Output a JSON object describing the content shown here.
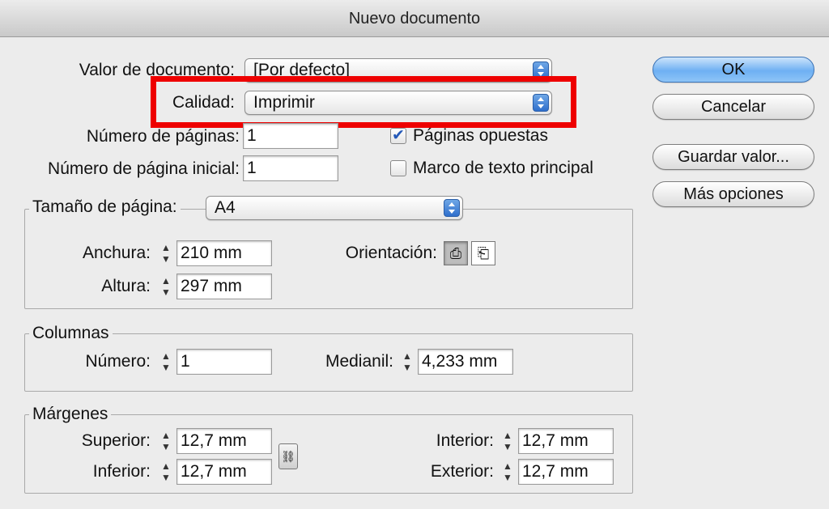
{
  "window": {
    "title": "Nuevo documento"
  },
  "preset": {
    "label": "Valor de documento:",
    "value": "[Por defecto]"
  },
  "intent": {
    "label": "Calidad:",
    "value": "Imprimir"
  },
  "pages": {
    "count_label": "Número de páginas:",
    "count_value": "1",
    "start_label": "Número de página inicial:",
    "start_value": "1",
    "facing_label": "Páginas opuestas",
    "facing_checked": true,
    "master_label": "Marco de texto principal",
    "master_checked": false
  },
  "page_size": {
    "label": "Tamaño de página:",
    "value": "A4",
    "width_label": "Anchura:",
    "width_value": "210 mm",
    "height_label": "Altura:",
    "height_value": "297 mm",
    "orientation_label": "Orientación:",
    "orientation": [
      "portrait",
      "landscape"
    ],
    "orientation_selected": "portrait"
  },
  "columns": {
    "title": "Columnas",
    "number_label": "Número:",
    "number_value": "1",
    "gutter_label": "Medianil:",
    "gutter_value": "4,233 mm"
  },
  "margins": {
    "title": "Márgenes",
    "top_label": "Superior:",
    "top_value": "12,7 mm",
    "bottom_label": "Inferior:",
    "bottom_value": "12,7 mm",
    "inside_label": "Interior:",
    "inside_value": "12,7 mm",
    "outside_label": "Exterior:",
    "outside_value": "12,7 mm"
  },
  "buttons": {
    "ok": "OK",
    "cancel": "Cancelar",
    "save_preset": "Guardar valor...",
    "more_options": "Más opciones"
  },
  "icons": {
    "portrait": "portrait-page-icon",
    "landscape": "landscape-page-icon",
    "chain": "chain-link-icon"
  },
  "colors": {
    "highlight": "#ee0000",
    "accent": "#6eb0f3",
    "check": "#2559b8"
  }
}
